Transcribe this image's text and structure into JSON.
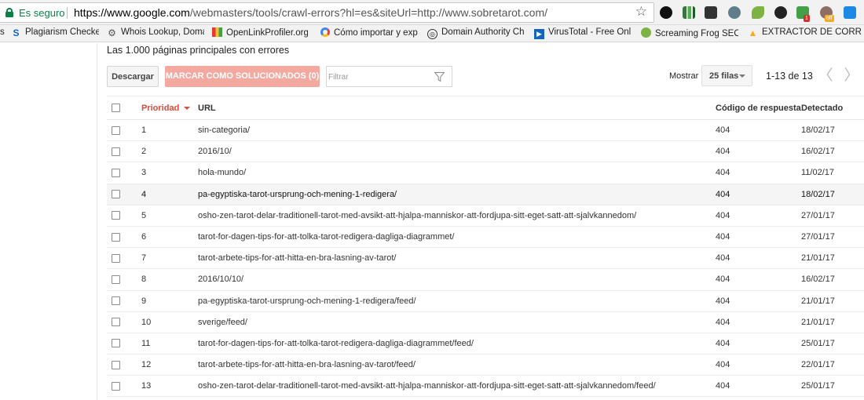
{
  "browser": {
    "security_label": "Es seguro",
    "url_host": "https://www.google.com",
    "url_path": "/webmasters/tools/crawl-errors?hl=es&siteUrl=http://www.sobretarot.com/",
    "bookmark_star": "☆",
    "extension_badges": [
      "1",
      "off"
    ]
  },
  "bookmarks": [
    {
      "label": "s",
      "icon": "bookmark-icon"
    },
    {
      "label": "Plagiarism Checker",
      "icon": "plagiarism-icon"
    },
    {
      "label": "Whois Lookup, Doma",
      "icon": "gear-icon"
    },
    {
      "label": "OpenLinkProfiler.org",
      "icon": "bar-chart-icon"
    },
    {
      "label": "Cómo importar y exp",
      "icon": "google-icon"
    },
    {
      "label": "Domain Authority Che",
      "icon": "da-icon"
    },
    {
      "label": "VirusTotal - Free Onli",
      "icon": "virustotal-icon"
    },
    {
      "label": "Screaming Frog SEO S",
      "icon": "frog-icon"
    },
    {
      "label": "EXTRACTOR DE CORR",
      "icon": "warning-icon"
    }
  ],
  "page": {
    "heading": "Las 1.000 páginas principales con errores",
    "download_label": "Descargar",
    "mark_fixed_label": "MARCAR COMO SOLUCIONADOS (0)",
    "filter_placeholder": "Filtrar",
    "show_label": "Mostrar",
    "rows_per_page": "25 filas",
    "page_info": "1-13 de 13",
    "prev_glyph": "〈",
    "next_glyph": "〉"
  },
  "table": {
    "columns": {
      "priority": "Prioridad",
      "url": "URL",
      "code": "Código de respuesta",
      "detected": "Detectado"
    },
    "rows": [
      {
        "priority": "1",
        "url": "sin-categoria/",
        "code": "404",
        "detected": "18/02/17"
      },
      {
        "priority": "2",
        "url": "2016/10/",
        "code": "404",
        "detected": "16/02/17"
      },
      {
        "priority": "3",
        "url": "hola-mundo/",
        "code": "404",
        "detected": "11/02/17"
      },
      {
        "priority": "4",
        "url": "pa-egyptiska-tarot-ursprung-och-mening-1-redigera/",
        "code": "404",
        "detected": "18/02/17"
      },
      {
        "priority": "5",
        "url": "osho-zen-tarot-delar-traditionell-tarot-med-avsikt-att-hjalpa-manniskor-att-fordjupa-sitt-eget-satt-att-sjalvkannedom/",
        "code": "404",
        "detected": "27/01/17"
      },
      {
        "priority": "6",
        "url": "tarot-for-dagen-tips-for-att-tolka-tarot-redigera-dagliga-diagrammet/",
        "code": "404",
        "detected": "27/01/17"
      },
      {
        "priority": "7",
        "url": "tarot-arbete-tips-for-att-hitta-en-bra-lasning-av-tarot/",
        "code": "404",
        "detected": "21/01/17"
      },
      {
        "priority": "8",
        "url": "2016/10/10/",
        "code": "404",
        "detected": "16/02/17"
      },
      {
        "priority": "9",
        "url": "pa-egyptiska-tarot-ursprung-och-mening-1-redigera/feed/",
        "code": "404",
        "detected": "21/01/17"
      },
      {
        "priority": "10",
        "url": "sverige/feed/",
        "code": "404",
        "detected": "21/01/17"
      },
      {
        "priority": "11",
        "url": "tarot-for-dagen-tips-for-att-tolka-tarot-redigera-dagliga-diagrammet/feed/",
        "code": "404",
        "detected": "25/01/17"
      },
      {
        "priority": "12",
        "url": "tarot-arbete-tips-for-att-hitta-en-bra-lasning-av-tarot/feed/",
        "code": "404",
        "detected": "22/01/17"
      },
      {
        "priority": "13",
        "url": "osho-zen-tarot-delar-traditionell-tarot-med-avsikt-att-hjalpa-manniskor-att-fordjupa-sitt-eget-satt-att-sjalvkannedom/feed/",
        "code": "404",
        "detected": "25/01/17"
      }
    ]
  },
  "colors": {
    "secure_green": "#0b8043",
    "sort_red": "#dd4b39",
    "mark_button": "#f3a9a0"
  }
}
